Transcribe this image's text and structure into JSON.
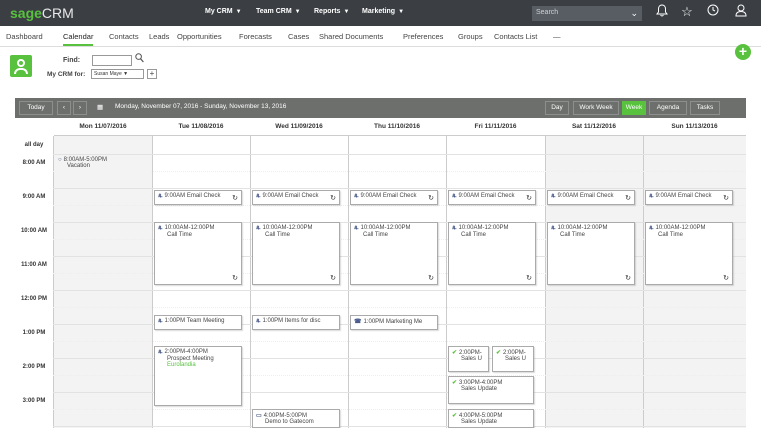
{
  "topbar": {
    "logo_sage": "sage",
    "logo_crm": "CRM",
    "nav": [
      {
        "label": "My CRM"
      },
      {
        "label": "Team CRM"
      },
      {
        "label": "Reports"
      },
      {
        "label": "Marketing"
      }
    ],
    "search_label": "Search",
    "icons": [
      "bell-icon",
      "star-icon",
      "clock-icon",
      "user-icon"
    ]
  },
  "subnav": {
    "items": [
      "Dashboard",
      "Calendar",
      "Contacts",
      "Leads",
      "Opportunities",
      "Forecasts",
      "Cases",
      "Shared Documents",
      "Preferences",
      "Groups",
      "Contacts List",
      "—"
    ],
    "active": "Calendar"
  },
  "find": {
    "label": "Find:",
    "value": "",
    "mycrm_label": "My CRM for:",
    "mycrm_value": "Susan Maye"
  },
  "toolbar": {
    "today": "Today",
    "range": "Monday, November 07, 2016 - Sunday, November 13, 2016",
    "views": [
      "Day",
      "Work Week",
      "Week",
      "Agenda",
      "Tasks"
    ],
    "active_view": "Week",
    "accent": "#58c13e"
  },
  "calendar": {
    "days": [
      "Mon 11/07/2016",
      "Tue 11/08/2016",
      "Wed 11/09/2016",
      "Thu 11/10/2016",
      "Fri 11/11/2016",
      "Sat 11/12/2016",
      "Sun 11/13/2016"
    ],
    "all_day_label": "all day",
    "times": [
      "8:00 AM",
      "9:00 AM",
      "10:00 AM",
      "11:00 AM",
      "12:00 PM",
      "1:00 PM",
      "2:00 PM",
      "3:00 PM",
      "4:00 PM"
    ],
    "appointments": [
      {
        "id": "vacation",
        "line1": "8:00AM-5:00PM",
        "line2": "Vacation"
      },
      {
        "id": "email-tue",
        "line1": "9:00AM Email Check"
      },
      {
        "id": "email-wed",
        "line1": "9:00AM Email Check"
      },
      {
        "id": "email-thu",
        "line1": "9:00AM Email Check"
      },
      {
        "id": "email-fri",
        "line1": "9:00AM Email Check"
      },
      {
        "id": "email-sat",
        "line1": "9:00AM Email Check"
      },
      {
        "id": "email-sun",
        "line1": "9:00AM Email Check"
      },
      {
        "id": "call-tue",
        "line1": "10:00AM-12:00PM",
        "line2": "Call Time"
      },
      {
        "id": "call-wed",
        "line1": "10:00AM-12:00PM",
        "line2": "Call Time"
      },
      {
        "id": "call-thu",
        "line1": "10:00AM-12:00PM",
        "line2": "Call Time"
      },
      {
        "id": "call-fri",
        "line1": "10:00AM-12:00PM",
        "line2": "Call Time"
      },
      {
        "id": "call-sat",
        "line1": "10:00AM-12:00PM",
        "line2": "Call Time"
      },
      {
        "id": "call-sun",
        "line1": "10:00AM-12:00PM",
        "line2": "Call Time"
      },
      {
        "id": "team-meeting",
        "line1": "1:00PM Team Meeting"
      },
      {
        "id": "items-disc",
        "line1": "1:00PM Items for disc"
      },
      {
        "id": "marketing",
        "line1": "1:00PM Marketing Me"
      },
      {
        "id": "prospect",
        "line1": "2:00PM-4:00PM",
        "line2": "Prospect Meeting",
        "line3": "Eurolandia"
      },
      {
        "id": "sales-a",
        "line1": "2:00PM-",
        "line2": "Sales U"
      },
      {
        "id": "sales-b",
        "line1": "2:00PM-",
        "line2": "Sales U"
      },
      {
        "id": "sales-c",
        "line1": "3:00PM-4:00PM",
        "line2": "Sales Update"
      },
      {
        "id": "demo",
        "line1": "4:00PM-5:00PM",
        "line2": "Demo to Gatecom"
      },
      {
        "id": "sales-d",
        "line1": "4:00PM-5:00PM",
        "line2": "Sales Update"
      }
    ]
  }
}
